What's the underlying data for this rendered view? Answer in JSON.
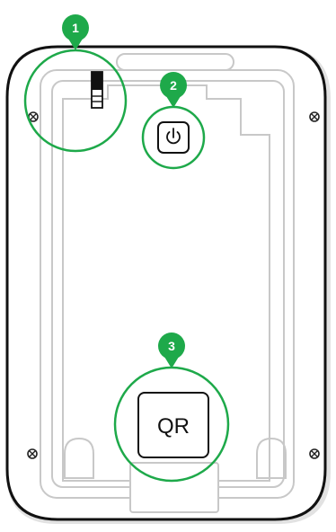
{
  "callouts": [
    {
      "number": "1",
      "target": "slider-switch"
    },
    {
      "number": "2",
      "target": "power-button"
    },
    {
      "number": "3",
      "target": "qr-code"
    }
  ],
  "qr_label": "QR",
  "colors": {
    "callout_green": "#1ea94a",
    "outline_dark": "#111111",
    "outline_gray": "#c8c8c8",
    "badge_text": "#ffffff",
    "screw": "#222222"
  },
  "icons": {
    "power": "power-icon",
    "screw": "screw-icon",
    "switch": "slider-switch-icon"
  }
}
